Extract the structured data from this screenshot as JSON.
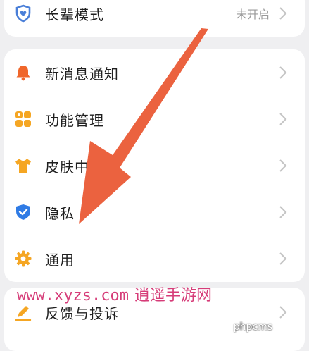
{
  "settings": {
    "elder_mode": {
      "label": "长辈模式",
      "value": "未开启",
      "icon": "heart-shield-icon",
      "color": "#4a7fd8"
    },
    "notifications": {
      "label": "新消息通知",
      "icon": "bell-icon",
      "color": "#f0662a"
    },
    "features": {
      "label": "功能管理",
      "icon": "grid-icon",
      "color": "#f5a623"
    },
    "skin": {
      "label": "皮肤中",
      "icon": "tshirt-icon",
      "color": "#f5a623"
    },
    "privacy": {
      "label": "隐私",
      "icon": "shield-check-icon",
      "color": "#2f7be5"
    },
    "general": {
      "label": "通用",
      "icon": "gear-icon",
      "color": "#f5a623"
    },
    "feedback": {
      "label": "反馈与投诉",
      "icon": "pencil-icon",
      "color": "#f5a623"
    }
  },
  "watermark": {
    "site": "www.xyzs.com",
    "site_cn": "逍遥手游网",
    "corner": "phpcms"
  },
  "annotation": {
    "color": "#ea5a35"
  }
}
